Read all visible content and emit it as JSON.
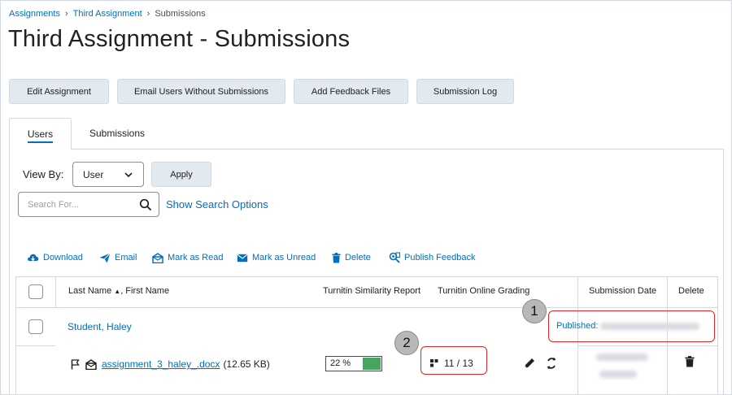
{
  "breadcrumb": {
    "items": [
      "Assignments",
      "Third Assignment",
      "Submissions"
    ],
    "separator": "›"
  },
  "page": {
    "title": "Third Assignment - Submissions"
  },
  "toolbar": {
    "edit_assignment": "Edit Assignment",
    "email_users": "Email Users Without Submissions",
    "add_feedback_files": "Add Feedback Files",
    "submission_log": "Submission Log"
  },
  "tabs": [
    {
      "label": "Users",
      "active": true
    },
    {
      "label": "Submissions",
      "active": false
    }
  ],
  "filters": {
    "view_by_label": "View By:",
    "view_by_value": "User",
    "apply_label": "Apply",
    "search_placeholder": "Search For...",
    "show_search_options": "Show Search Options"
  },
  "actions": {
    "download": "Download",
    "email": "Email",
    "mark_read": "Mark as Read",
    "mark_unread": "Mark as Unread",
    "delete": "Delete",
    "publish_feedback": "Publish Feedback"
  },
  "table": {
    "headers": {
      "name_last": "Last Name",
      "name_sort_indicator": "▲",
      "name_first": ", First Name",
      "similarity": "Turnitin Similarity Report",
      "grading": "Turnitin Online Grading",
      "submission_date": "Submission Date",
      "delete": "Delete"
    },
    "rows": [
      {
        "student": "Student, Haley",
        "published_label": "Published:",
        "file": {
          "name": "assignment_3_haley_.docx",
          "size": "(12.65 KB)"
        },
        "similarity_value": "22 %",
        "similarity_fraction": 0.22,
        "grading_score": "11 / 13"
      }
    ]
  },
  "callouts": [
    "1",
    "2"
  ],
  "colors": {
    "link": "#006fbf",
    "button_bg": "#e3e9f1",
    "border": "#d3d9e3",
    "similarity_green": "#46a661",
    "callout_red": "#e0262b"
  }
}
